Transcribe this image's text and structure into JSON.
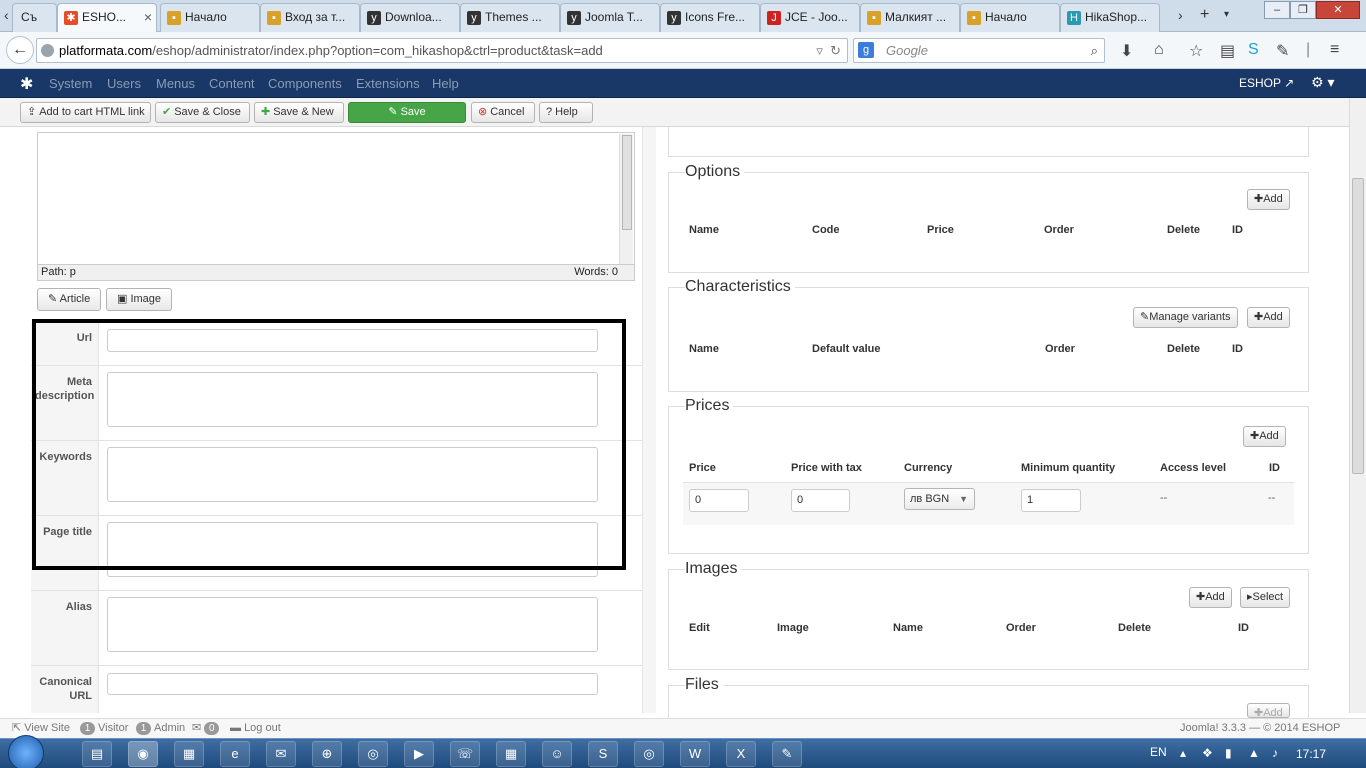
{
  "browser": {
    "tabs": [
      {
        "label": "Съ",
        "favicon": "globe-icon",
        "color": "#888888"
      },
      {
        "label": "ESHO...",
        "favicon": "joomla-icon",
        "color": "#e44d26",
        "active": true
      },
      {
        "label": "Начало",
        "favicon": "page-icon",
        "color": "#d8a12a"
      },
      {
        "label": "Вход за т...",
        "favicon": "page-icon",
        "color": "#d8a12a"
      },
      {
        "label": "Downloa...",
        "favicon": "yoo-icon",
        "color": "#333333"
      },
      {
        "label": "Themes ...",
        "favicon": "yoo-icon",
        "color": "#333333"
      },
      {
        "label": "Joomla T...",
        "favicon": "yoo-icon",
        "color": "#333333"
      },
      {
        "label": "Icons Fre...",
        "favicon": "yoo-icon",
        "color": "#333333"
      },
      {
        "label": "JCE - Joo...",
        "favicon": "jce-icon",
        "color": "#cc2222"
      },
      {
        "label": "Малкият ...",
        "favicon": "page-icon",
        "color": "#d8a12a"
      },
      {
        "label": "Начало",
        "favicon": "page-icon",
        "color": "#d8a12a"
      },
      {
        "label": "HikaShop...",
        "favicon": "hikashop-icon",
        "color": "#2a9ab0"
      }
    ],
    "url_host": "platformata.com",
    "url_path": "/eshop/administrator/index.php?option=com_hikashop&ctrl=product&task=add",
    "search_placeholder": "Google"
  },
  "adminbar": {
    "menus": [
      "System",
      "Users",
      "Menus",
      "Content",
      "Components",
      "Extensions",
      "Help"
    ],
    "site_link": "ESHOP"
  },
  "toolbar": {
    "add_to_cart": "Add to cart HTML link",
    "save_close": "Save & Close",
    "save_new": "Save & New",
    "save": "Save",
    "cancel": "Cancel",
    "help": "Help"
  },
  "editor": {
    "path": "Path: p",
    "words": "Words: 0",
    "article_btn": "Article",
    "image_btn": "Image"
  },
  "meta": {
    "url": "Url",
    "meta_description": "Meta description",
    "keywords": "Keywords",
    "page_title": "Page title",
    "alias": "Alias",
    "canonical_url": "Canonical URL"
  },
  "options": {
    "title": "Options",
    "add": "Add",
    "columns": [
      "Name",
      "Code",
      "Price",
      "Order",
      "Delete",
      "ID"
    ]
  },
  "characteristics": {
    "title": "Characteristics",
    "manage_variants": "Manage variants",
    "add": "Add",
    "columns": [
      "Name",
      "Default value",
      "Order",
      "Delete",
      "ID"
    ]
  },
  "prices": {
    "title": "Prices",
    "add": "Add",
    "columns": [
      "Price",
      "Price with tax",
      "Currency",
      "Minimum quantity",
      "Access level",
      "ID"
    ],
    "row": {
      "price": "0",
      "price_with_tax": "0",
      "currency": "лв BGN",
      "min_qty": "1",
      "access": "--",
      "id": "--"
    }
  },
  "images": {
    "title": "Images",
    "add": "Add",
    "select": "Select",
    "columns": [
      "Edit",
      "Image",
      "Name",
      "Order",
      "Delete",
      "ID"
    ]
  },
  "files": {
    "title": "Files",
    "add": "Add"
  },
  "statusbar": {
    "view_site": "View Site",
    "visitors_count": "1",
    "visitor": "Visitor",
    "admins_count": "1",
    "admin": "Admin",
    "messages_count": "0",
    "logout": "Log out",
    "version": "Joomla! 3.3.3 — © 2014 ESHOP"
  },
  "taskbar": {
    "lang": "EN",
    "time": "17:17"
  }
}
